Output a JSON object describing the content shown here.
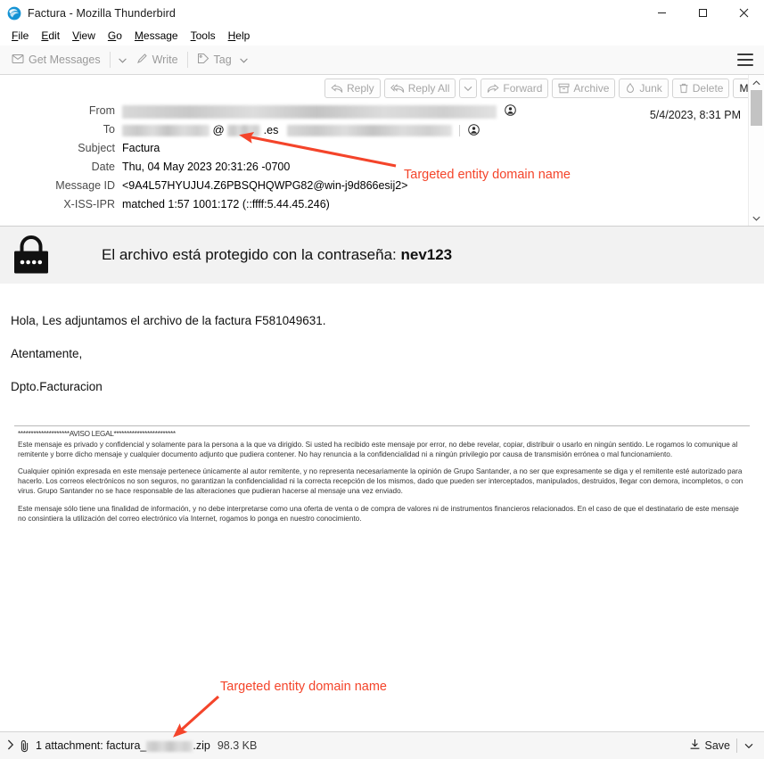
{
  "window": {
    "title": "Factura - Mozilla Thunderbird",
    "app_icon": "thunderbird-icon",
    "minimize_label": "─",
    "maximize_label": "□",
    "close_label": "✕"
  },
  "menubar": {
    "items": [
      {
        "label": "File",
        "accel": "F"
      },
      {
        "label": "Edit",
        "accel": "E"
      },
      {
        "label": "View",
        "accel": "V"
      },
      {
        "label": "Go",
        "accel": "G"
      },
      {
        "label": "Message",
        "accel": "M"
      },
      {
        "label": "Tools",
        "accel": "T"
      },
      {
        "label": "Help",
        "accel": "H"
      }
    ]
  },
  "toolbar": {
    "get_messages": "Get Messages",
    "write": "Write",
    "tag": "Tag",
    "app_menu_icon": "hamburger-menu-icon"
  },
  "header_actions": {
    "reply": "Reply",
    "reply_all": "Reply All",
    "forward": "Forward",
    "archive": "Archive",
    "junk": "Junk",
    "delete": "Delete",
    "more": "More"
  },
  "email_headers": {
    "from_label": "From",
    "from_value_redacted": true,
    "to_label": "To",
    "to_domain_suffix": ".es",
    "to_at_symbol": "@",
    "subject_label": "Subject",
    "subject_value": "Factura",
    "date_label": "Date",
    "date_value": "Thu, 04 May 2023 20:31:26 -0700",
    "message_id_label": "Message ID",
    "message_id_value": "<9A4L57HYUJU4.Z6PBSQHQWPG82@win-j9d866esij2>",
    "xissipr_label": "X-ISS-IPR",
    "xissipr_value": "matched 1:57 1001:172 (::ffff:5.44.45.246)",
    "received_timestamp": "5/4/2023, 8:31 PM"
  },
  "password_banner": {
    "icon": "padlock-icon",
    "text_prefix": "El archivo está protegido con la contraseña: ",
    "password": "nev123"
  },
  "message_body": {
    "greeting": "Hola, Les adjuntamos el archivo de la factura F581049631.",
    "closing": "Atentamente,",
    "signature": "Dpto.Facturacion",
    "legal_stars_header": "********************AVISO LEGAL************************",
    "legal_paragraphs": [
      "Este mensaje es privado y confidencial y solamente para la persona a la que va dirigido. Si usted ha recibido este mensaje por error, no debe revelar, copiar, distribuir o usarlo en ningún sentido. Le rogamos lo comunique al remitente y borre dicho mensaje y cualquier documento adjunto que pudiera contener. No hay renuncia a la confidencialidad ni a ningún privilegio por causa de transmisión errónea o mal funcionamiento.",
      "Cualquier opinión expresada en este mensaje pertenece únicamente al autor remitente, y no representa necesariamente la opinión de Grupo Santander, a no ser que expresamente se diga y el remitente esté autorizado para hacerlo. Los correos electrónicos no son seguros, no garantizan la confidencialidad ni la correcta recepción de los mismos, dado que pueden ser interceptados, manipulados, destruidos, llegar con demora, incompletos, o con virus. Grupo Santander no se hace responsable de las alteraciones que pudieran hacerse al mensaje una vez enviado.",
      "Este mensaje sólo tiene una finalidad de información, y no debe interpretarse como una oferta de venta o de compra de valores ni de instrumentos financieros relacionados. En el caso de que el destinatario de este mensaje no consintiera la utilización del correo electrónico vía Internet, rogamos lo ponga en nuestro conocimiento."
    ]
  },
  "attachment_bar": {
    "expand_icon": "chevron-right-icon",
    "clip_icon": "paperclip-icon",
    "label_prefix": "1 attachment: factura_",
    "label_suffix": ".zip",
    "size": "98.3 KB",
    "save_label": "Save",
    "save_icon": "download-icon",
    "save_caret_icon": "chevron-down-icon"
  },
  "annotations": {
    "color": "#F4442A",
    "top_text": "Targeted entity domain name",
    "bottom_text": "Targeted entity domain name"
  }
}
